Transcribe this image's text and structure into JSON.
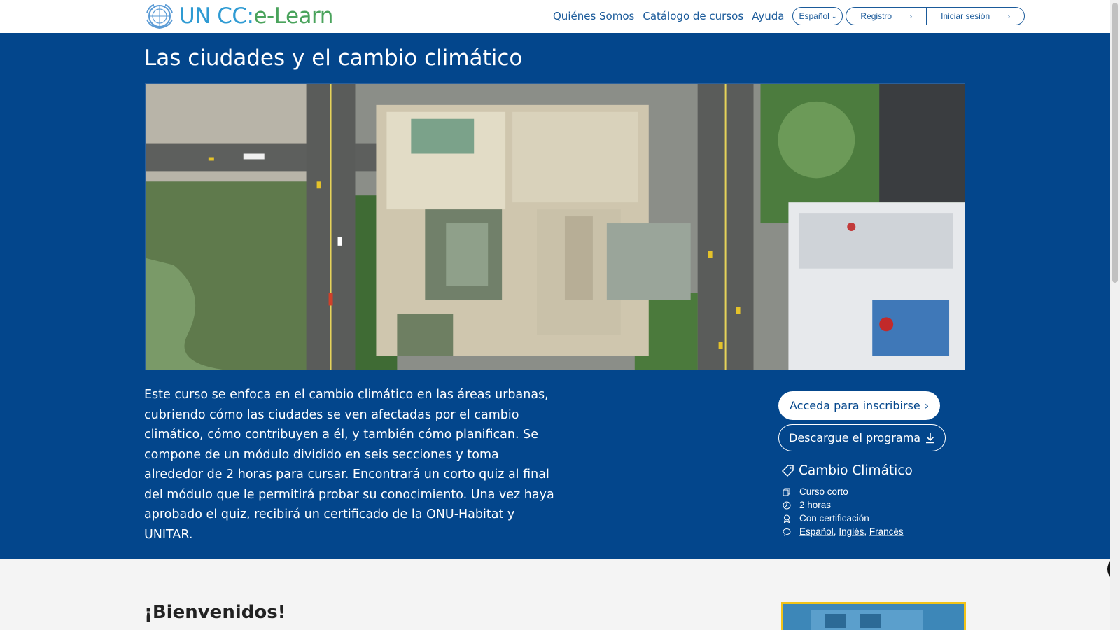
{
  "header": {
    "logo_text": "UN CC:",
    "logo_text_accent": "e-Learn",
    "nav": [
      "Quiénes Somos",
      "Catálogo de cursos",
      "Ayuda"
    ],
    "language": "Español",
    "register": "Registro",
    "login": "Iniciar sesión"
  },
  "course": {
    "title": "Las ciudades y el cambio climático",
    "description": "Este curso se enfoca en el cambio climático en las áreas urbanas, cubriendo cómo las ciudades se ven afectadas por el cambio climático, cómo contribuyen a él, y también cómo planifican. Se compone de un módulo dividido en seis secciones y toma alrededor de 2 horas para cursar. Encontrará un corto quiz al final del módulo que le permitirá probar su conocimiento. Una vez haya aprobado el quiz, recibirá un certificado de la ONU-Habitat y UNITAR.",
    "enroll_button": "Acceda para inscribirse",
    "download_button": "Descargue el programa",
    "topic": "Cambio Climático",
    "type": "Curso corto",
    "duration": "2 horas",
    "certification": "Con certificación",
    "languages": [
      "Español",
      "Inglés",
      "Francés"
    ]
  },
  "welcome": {
    "heading": "¡Bienvenidos!"
  },
  "colors": {
    "hero_bg": "#03468c",
    "brand_blue": "#2f9bd3",
    "brand_green": "#4aa35c"
  }
}
